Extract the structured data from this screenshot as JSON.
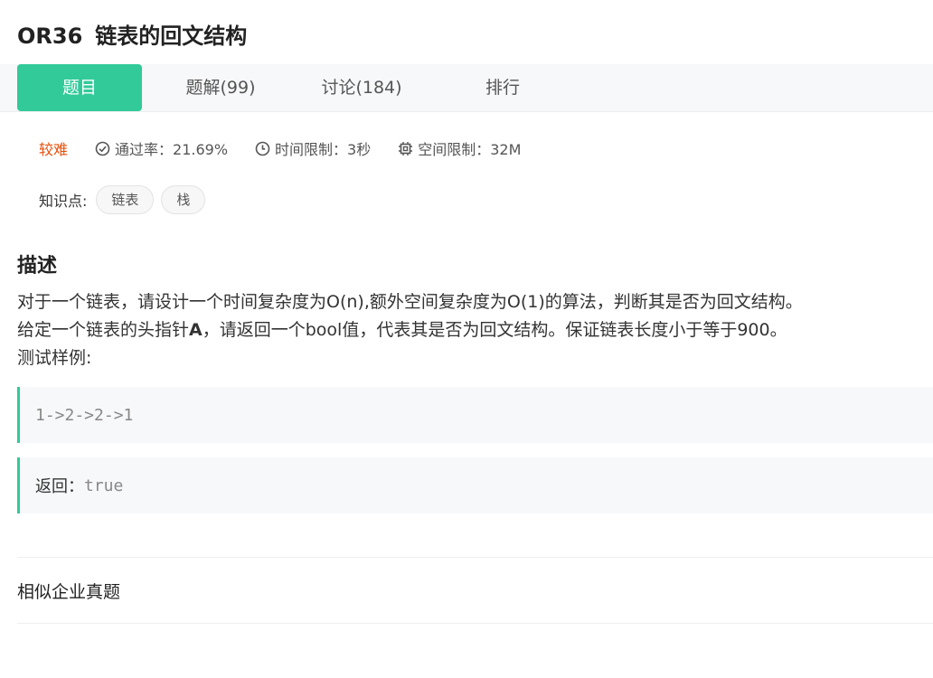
{
  "problem": {
    "id": "OR36",
    "title": "链表的回文结构"
  },
  "tabs": [
    {
      "label": "题目",
      "active": true
    },
    {
      "label": "题解(99)",
      "active": false
    },
    {
      "label": "讨论(184)",
      "active": false
    },
    {
      "label": "排行",
      "active": false
    }
  ],
  "meta": {
    "difficulty": "较难",
    "pass_rate": "通过率：21.69%",
    "time_limit": "时间限制：3秒",
    "memory_limit": "空间限制：32M"
  },
  "knowledge": {
    "label": "知识点:",
    "tags": [
      "链表",
      "栈"
    ]
  },
  "description": {
    "heading": "描述",
    "line1": "对于一个链表，请设计一个时间复杂度为O(n),额外空间复杂度为O(1)的算法，判断其是否为回文结构。",
    "line2_pre": "给定一个链表的头指针",
    "line2_bold": "A",
    "line2_post": "，请返回一个bool值，代表其是否为回文结构。保证链表长度小于等于900。",
    "line3": "测试样例:"
  },
  "examples": {
    "input": "1->2->2->1",
    "output_label": "返回：",
    "output_value": "true"
  },
  "similar": {
    "label": "相似企业真题"
  },
  "colors": {
    "accent": "#32ca99",
    "difficulty": "#e6500c"
  }
}
